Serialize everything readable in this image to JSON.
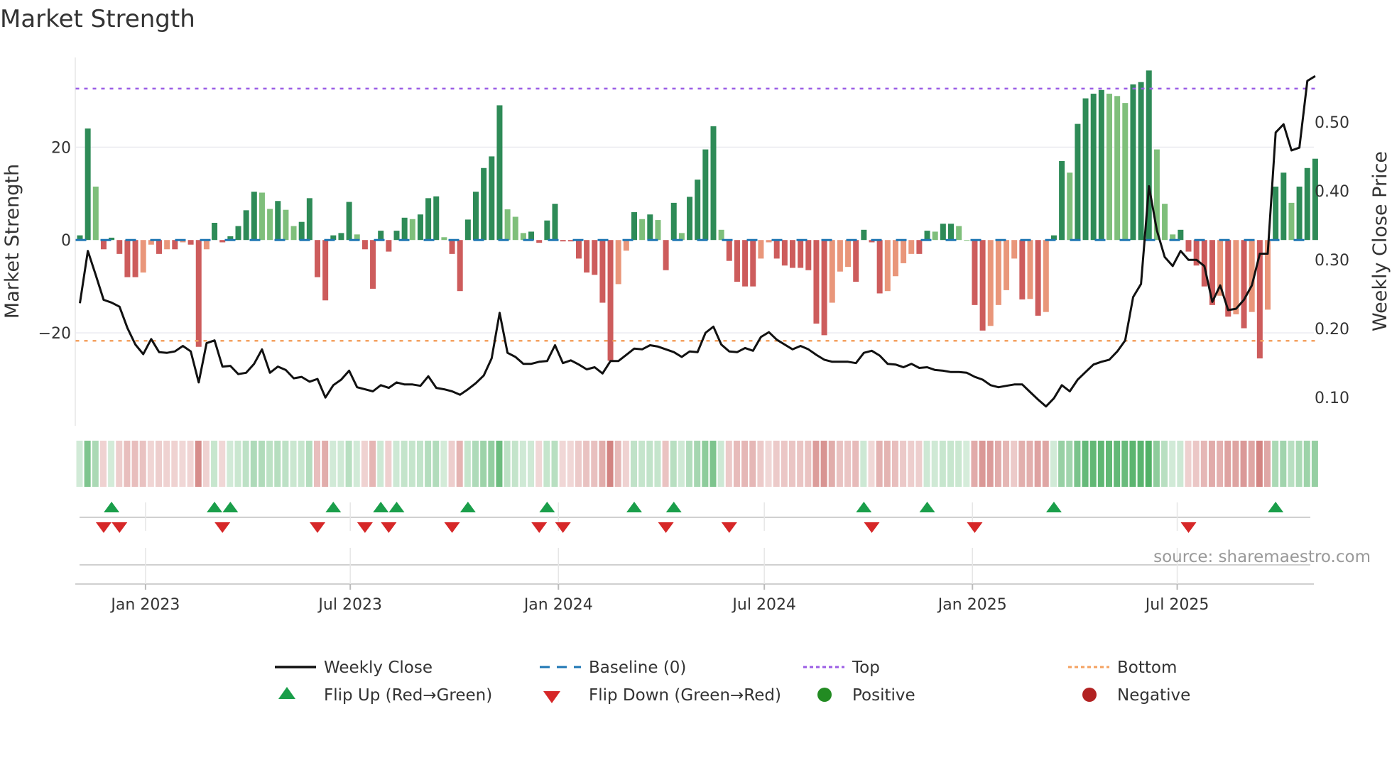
{
  "chart_data": {
    "type": "bar",
    "title": "Market Strength",
    "ylabel": "Market Strength",
    "ylabel_right": "Weekly Close Price",
    "ylim": [
      -40,
      39.3
    ],
    "ylim_right": [
      0.059,
      0.594
    ],
    "yticks": [
      20,
      0,
      -20
    ],
    "ytick_labels": [
      "20",
      "0",
      "−20"
    ],
    "yticks_right": [
      0.5,
      0.4,
      0.3,
      0.2,
      0.1
    ],
    "ytick_labels_right": [
      "0.50",
      "0.40",
      "0.30",
      "0.20",
      "0.10"
    ],
    "start_date": "2022-11-04",
    "frequency": "weekly",
    "xticks": [
      {
        "date": "2023-01-01",
        "label": "Jan 2023"
      },
      {
        "date": "2023-07-01",
        "label": "Jul 2023"
      },
      {
        "date": "2024-01-01",
        "label": "Jan 2024"
      },
      {
        "date": "2024-07-01",
        "label": "Jul 2024"
      },
      {
        "date": "2025-01-01",
        "label": "Jan 2025"
      },
      {
        "date": "2025-07-01",
        "label": "Jul 2025"
      }
    ],
    "top_level": 32.6,
    "bottom_level": -21.7,
    "baseline": 0,
    "strength": [
      1,
      24,
      11.5,
      -2,
      0.5,
      -3,
      -8,
      -8,
      -7,
      -1,
      -3,
      -2,
      -2,
      -0.5,
      -1,
      -23,
      -2,
      3.7,
      -0.5,
      0.8,
      3,
      6.4,
      10.4,
      10.2,
      6.7,
      8.4,
      6.5,
      3,
      3.9,
      9,
      -8,
      -13,
      1,
      1.5,
      8.2,
      1.2,
      -2,
      -10.5,
      2,
      -2.5,
      2,
      4.8,
      4.5,
      5.5,
      9,
      9.4,
      0.6,
      -3,
      -11,
      4.4,
      10.4,
      15.5,
      18,
      29,
      6.6,
      5,
      1.5,
      1.8,
      -0.6,
      4.2,
      7.8,
      -0.3,
      -0.3,
      -4,
      -7,
      -7.5,
      -13.5,
      -26,
      -9.5,
      -2.3,
      6,
      4.5,
      5.5,
      4.3,
      -6.5,
      8,
      1.5,
      9.3,
      13,
      19.5,
      24.5,
      2.2,
      -4.5,
      -9,
      -10,
      -10,
      -4,
      -0.5,
      -4,
      -5.5,
      -6,
      -6,
      -6.5,
      -18,
      -20.5,
      -13.5,
      -6.8,
      -5.8,
      -9,
      2.2,
      -0.5,
      -11.5,
      -11,
      -7.8,
      -5,
      -3,
      -3,
      2,
      1.8,
      3.5,
      3.5,
      3,
      0,
      -14,
      -19.5,
      -18.5,
      -14,
      -10.8,
      -4,
      -12.8,
      -12.7,
      -16.3,
      -15.5,
      1,
      17,
      14.5,
      25,
      30.5,
      31.5,
      32.3,
      31.5,
      31,
      29.5,
      33.5,
      34,
      36.5,
      19.5,
      7.8,
      1.2,
      2.2,
      -2.5,
      -5.5,
      -10,
      -14,
      -12,
      -16.5,
      -16,
      -19,
      -15.5,
      -25.5,
      -15,
      11.5,
      14.5,
      8,
      11.5,
      15.5,
      17.5
    ],
    "weekly_close": [
      0.237,
      0.313,
      0.278,
      0.242,
      0.238,
      0.232,
      0.201,
      0.177,
      0.163,
      0.185,
      0.166,
      0.165,
      0.167,
      0.175,
      0.167,
      0.122,
      0.179,
      0.183,
      0.145,
      0.146,
      0.134,
      0.136,
      0.149,
      0.17,
      0.136,
      0.145,
      0.14,
      0.128,
      0.13,
      0.123,
      0.127,
      0.1,
      0.118,
      0.126,
      0.139,
      0.115,
      0.112,
      0.109,
      0.118,
      0.114,
      0.122,
      0.119,
      0.119,
      0.117,
      0.131,
      0.114,
      0.112,
      0.109,
      0.104,
      0.112,
      0.121,
      0.132,
      0.157,
      0.223,
      0.165,
      0.159,
      0.149,
      0.149,
      0.152,
      0.153,
      0.176,
      0.15,
      0.154,
      0.148,
      0.141,
      0.144,
      0.135,
      0.153,
      0.153,
      0.162,
      0.171,
      0.17,
      0.176,
      0.174,
      0.17,
      0.166,
      0.159,
      0.167,
      0.166,
      0.194,
      0.203,
      0.177,
      0.167,
      0.166,
      0.172,
      0.168,
      0.188,
      0.195,
      0.184,
      0.177,
      0.17,
      0.175,
      0.17,
      0.162,
      0.155,
      0.152,
      0.152,
      0.152,
      0.15,
      0.165,
      0.168,
      0.161,
      0.149,
      0.148,
      0.144,
      0.149,
      0.143,
      0.144,
      0.14,
      0.139,
      0.137,
      0.137,
      0.136,
      0.13,
      0.126,
      0.118,
      0.115,
      0.117,
      0.119,
      0.119,
      0.108,
      0.097,
      0.087,
      0.099,
      0.118,
      0.109,
      0.126,
      0.137,
      0.148,
      0.152,
      0.155,
      0.167,
      0.183,
      0.246,
      0.265,
      0.407,
      0.343,
      0.304,
      0.291,
      0.313,
      0.3,
      0.3,
      0.291,
      0.239,
      0.263,
      0.227,
      0.229,
      0.242,
      0.263,
      0.309,
      0.309,
      0.485,
      0.497,
      0.459,
      0.463,
      0.56,
      0.567
    ],
    "legend": {
      "placement": "bottom",
      "items": [
        {
          "key": "close",
          "label": "Weekly Close"
        },
        {
          "key": "baseline",
          "label": "Baseline (0)"
        },
        {
          "key": "top",
          "label": "Top"
        },
        {
          "key": "bottom",
          "label": "Bottom"
        },
        {
          "key": "flip_up",
          "label": "Flip Up (Red→Green)"
        },
        {
          "key": "flip_down",
          "label": "Flip Down (Green→Red)"
        },
        {
          "key": "positive",
          "label": "Positive"
        },
        {
          "key": "negative",
          "label": "Negative"
        }
      ]
    },
    "source": "source: sharemaestro.com"
  },
  "colors": {
    "green_strong": "#2e8b57",
    "green_weak": "#7fbf7b",
    "red_strong": "#cd5c5c",
    "red_weak": "#e9967a",
    "close": "#111111",
    "baseline": "#1f77b4",
    "top": "#9b5de5",
    "bottom": "#f4a261",
    "flip_up": "#1a9e4a",
    "flip_down": "#d62728",
    "positive": "#228b22",
    "negative": "#b22222"
  }
}
